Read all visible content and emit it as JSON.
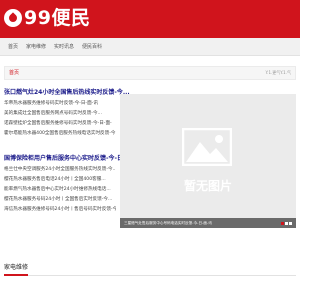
{
  "header": {
    "logo_text": "99便民",
    "brand_color": "#d0141c"
  },
  "nav": {
    "items": [
      "首页",
      "家电维修",
      "实时讯息",
      "便民百科"
    ]
  },
  "breadcrumb": {
    "home": "首页",
    "right": "Y.1.更气Y.1.气"
  },
  "section1": {
    "title": "张口燃气灶24小时全国售后热线实时反馈-今...",
    "items": [
      "华帝热水器服务维修号码实时反馈-今-日-面-讯",
      "美的集成灶全国售后服务网点号码实时反馈-今...",
      "诺森壁挂炉全国售后服务维修号码实时反馈-今-日-面-",
      "霍尔塔能热水器400全国售后服务热线电话实时反馈-今..."
    ]
  },
  "section2": {
    "title": "国博保险柜用户售后服务中心实时反馈-今-日-...",
    "items": [
      "格兰仕中央空调服务24小时全国服务热线实时反馈-今...",
      "樱花热水器服务售后电话24小时丨全国400客服...",
      "能率燃气热水器售后中心实时24小时维修热线电话...",
      "樱花热水器服务号码24小时丨全国售后实时反馈-今...",
      "海信热水器服务维修号码24小时丨售后号码实时反馈-今..."
    ]
  },
  "placeholder": {
    "text": "暂无图片",
    "caption": "三星燃气灶售后服务中心号码电话实时反馈-今-日-面-讯"
  },
  "bottom": {
    "title": "家电维修"
  }
}
